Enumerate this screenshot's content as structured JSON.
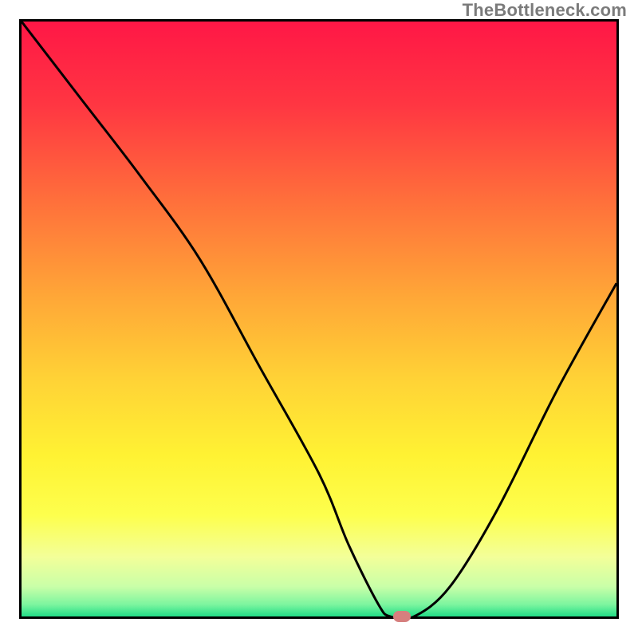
{
  "watermark": "TheBottleneck.com",
  "chart_data": {
    "type": "line",
    "title": "",
    "xlabel": "",
    "ylabel": "",
    "xlim": [
      0,
      100
    ],
    "ylim": [
      0,
      100
    ],
    "series": [
      {
        "name": "curve",
        "x": [
          0,
          10,
          20,
          30,
          40,
          50,
          55,
          60,
          62,
          66,
          72,
          80,
          90,
          100
        ],
        "y": [
          100,
          87,
          74,
          60,
          42,
          24,
          12,
          2,
          0,
          0,
          5,
          18,
          38,
          56
        ]
      }
    ],
    "marker": {
      "x": 64,
      "y": 0,
      "color": "#d67f7e"
    },
    "background_gradient": {
      "stops": [
        {
          "pct": 0,
          "color": "#ff1746"
        },
        {
          "pct": 14,
          "color": "#ff3642"
        },
        {
          "pct": 30,
          "color": "#ff6f3b"
        },
        {
          "pct": 46,
          "color": "#ffa637"
        },
        {
          "pct": 60,
          "color": "#ffd236"
        },
        {
          "pct": 73,
          "color": "#fff233"
        },
        {
          "pct": 83,
          "color": "#fdff4d"
        },
        {
          "pct": 90,
          "color": "#f3ff99"
        },
        {
          "pct": 95,
          "color": "#c9ffa8"
        },
        {
          "pct": 98,
          "color": "#7cf59f"
        },
        {
          "pct": 100,
          "color": "#22dd87"
        }
      ]
    }
  }
}
